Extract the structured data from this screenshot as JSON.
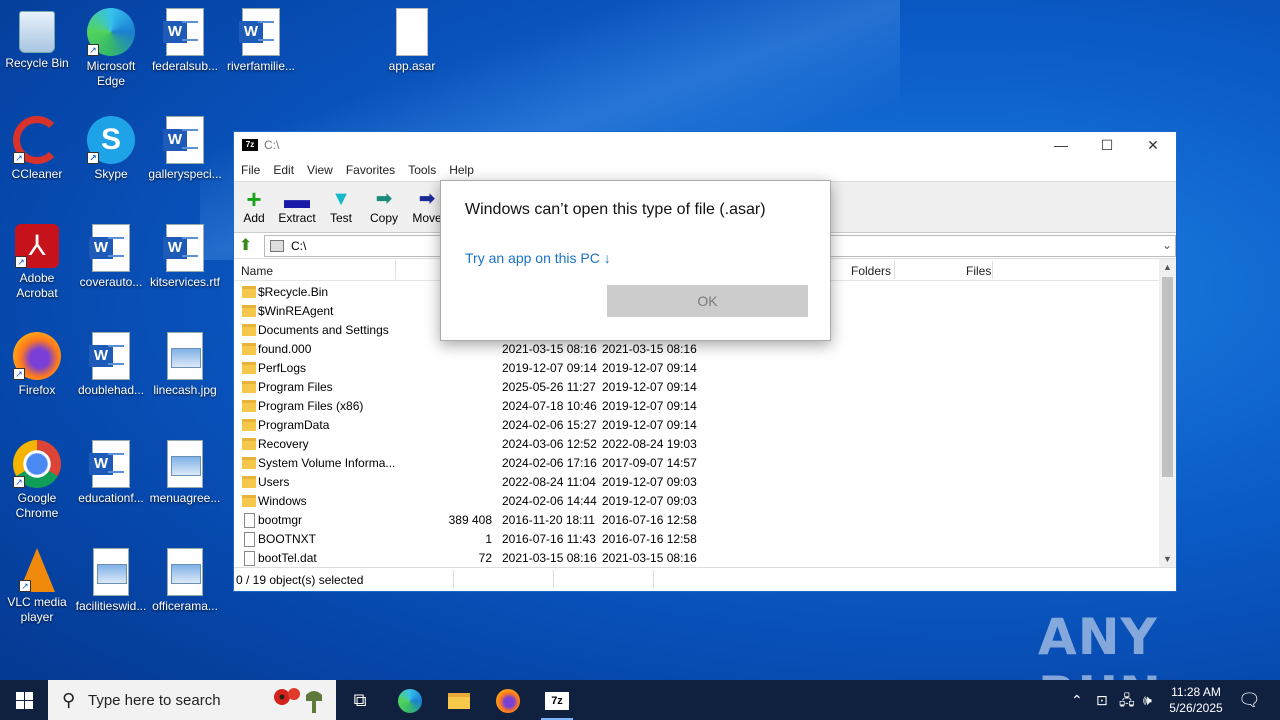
{
  "desktop": {
    "icons": [
      {
        "label": "Recycle Bin",
        "icon": "recycle-bin-icon"
      },
      {
        "label": "Microsoft Edge",
        "icon": "edge-icon"
      },
      {
        "label": "federalsub...",
        "icon": "word-doc-icon"
      },
      {
        "label": "riverfamilie...",
        "icon": "word-doc-icon"
      },
      {
        "label": "app.asar",
        "icon": "blank-file-icon"
      },
      {
        "label": "CCleaner",
        "icon": "ccleaner-icon"
      },
      {
        "label": "Skype",
        "icon": "skype-icon"
      },
      {
        "label": "galleryspeci...",
        "icon": "word-doc-icon"
      },
      {
        "label": "Adobe Acrobat",
        "icon": "acrobat-icon"
      },
      {
        "label": "coverauto...",
        "icon": "word-doc-icon"
      },
      {
        "label": "kitservices.rtf",
        "icon": "word-doc-icon"
      },
      {
        "label": "Firefox",
        "icon": "firefox-icon"
      },
      {
        "label": "doublehad...",
        "icon": "word-doc-icon"
      },
      {
        "label": "linecash.jpg",
        "icon": "image-file-icon"
      },
      {
        "label": "Google Chrome",
        "icon": "chrome-icon"
      },
      {
        "label": "educationf...",
        "icon": "word-doc-icon"
      },
      {
        "label": "menuagree...",
        "icon": "image-file-icon"
      },
      {
        "label": "VLC media player",
        "icon": "vlc-icon"
      },
      {
        "label": "facilitieswid...",
        "icon": "image-file-icon"
      },
      {
        "label": "officerama...",
        "icon": "image-file-icon"
      }
    ]
  },
  "window": {
    "title": "C:\\",
    "app_icon": "7z",
    "menu": [
      "File",
      "Edit",
      "View",
      "Favorites",
      "Tools",
      "Help"
    ],
    "toolbar": [
      {
        "label": "Add",
        "icon": "plus-icon"
      },
      {
        "label": "Extract",
        "icon": "minus-icon"
      },
      {
        "label": "Test",
        "icon": "check-icon"
      },
      {
        "label": "Copy",
        "icon": "copy-arrow-icon"
      },
      {
        "label": "Move",
        "icon": "move-arrow-icon"
      }
    ],
    "address": "C:\\",
    "columns": {
      "name": "Name",
      "folders": "Folders",
      "files": "Files"
    },
    "rows": [
      {
        "name": "$Recycle.Bin",
        "size": "",
        "modified": "",
        "created": "",
        "type": "folder"
      },
      {
        "name": "$WinREAgent",
        "size": "",
        "modified": "",
        "created": "",
        "type": "folder"
      },
      {
        "name": "Documents and Settings",
        "size": "",
        "modified": "",
        "created": "",
        "type": "folder"
      },
      {
        "name": "found.000",
        "size": "",
        "modified": "2021-03-15 08:16",
        "created": "2021-03-15 08:16",
        "type": "folder"
      },
      {
        "name": "PerfLogs",
        "size": "",
        "modified": "2019-12-07 09:14",
        "created": "2019-12-07 09:14",
        "type": "folder"
      },
      {
        "name": "Program Files",
        "size": "",
        "modified": "2025-05-26 11:27",
        "created": "2019-12-07 09:14",
        "type": "folder"
      },
      {
        "name": "Program Files (x86)",
        "size": "",
        "modified": "2024-07-18 10:46",
        "created": "2019-12-07 09:14",
        "type": "folder"
      },
      {
        "name": "ProgramData",
        "size": "",
        "modified": "2024-02-06 15:27",
        "created": "2019-12-07 09:14",
        "type": "folder"
      },
      {
        "name": "Recovery",
        "size": "",
        "modified": "2024-03-06 12:52",
        "created": "2022-08-24 19:03",
        "type": "folder"
      },
      {
        "name": "System Volume Informa...",
        "size": "",
        "modified": "2024-02-06 17:16",
        "created": "2017-09-07 14:57",
        "type": "folder"
      },
      {
        "name": "Users",
        "size": "",
        "modified": "2022-08-24 11:04",
        "created": "2019-12-07 09:03",
        "type": "folder"
      },
      {
        "name": "Windows",
        "size": "",
        "modified": "2024-02-06 14:44",
        "created": "2019-12-07 09:03",
        "type": "folder"
      },
      {
        "name": "bootmgr",
        "size": "389 408",
        "modified": "2016-11-20 18:11",
        "created": "2016-07-16 12:58",
        "type": "file"
      },
      {
        "name": "BOOTNXT",
        "size": "1",
        "modified": "2016-07-16 11:43",
        "created": "2016-07-16 12:58",
        "type": "file"
      },
      {
        "name": "bootTel.dat",
        "size": "72",
        "modified": "2021-03-15 08:16",
        "created": "2021-03-15 08:16",
        "type": "file"
      }
    ],
    "status": "0 / 19 object(s) selected"
  },
  "dialog": {
    "title": "Windows can’t open this type of file (.asar)",
    "link": "Try an app on this PC ↓",
    "ok": "OK"
  },
  "watermark": "ANY RUN",
  "taskbar": {
    "search_placeholder": "Type here to search",
    "time": "11:28 AM",
    "date": "5/26/2025",
    "accent": "#10213f"
  }
}
